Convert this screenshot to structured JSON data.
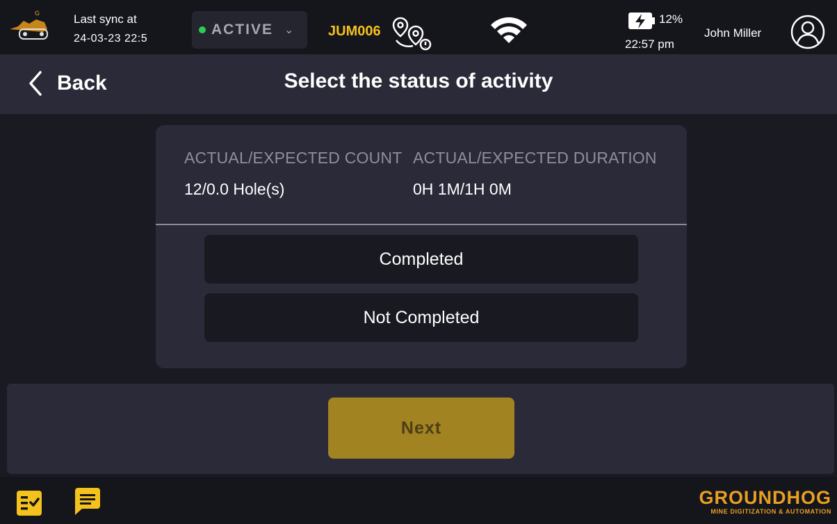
{
  "statusbar": {
    "sync_label": "Last sync at",
    "sync_time": "24-03-23 22:5",
    "status": "ACTIVE",
    "machine_id": "JUM006",
    "battery_percent": "12%",
    "time": "22:57 pm",
    "user_name": "John Miller",
    "icons": [
      "excavator-logo-icon",
      "route-icon",
      "wifi-icon",
      "battery-charging-icon",
      "user-avatar-icon"
    ]
  },
  "header": {
    "back_label": "Back",
    "title": "Select the status of activity"
  },
  "card": {
    "count_label": "ACTUAL/EXPECTED COUNT",
    "count_value": "12/0.0 Hole(s)",
    "duration_label": "ACTUAL/EXPECTED DURATION",
    "duration_value": "0H 1M/1H 0M",
    "options": [
      {
        "label": "Completed"
      },
      {
        "label": "Not Completed"
      }
    ]
  },
  "footer": {
    "next_label": "Next"
  },
  "bottombar": {
    "brand_name": "GROUNDHOG",
    "brand_tagline": "MINE DIGITIZATION & AUTOMATION",
    "icons": [
      "checklist-icon",
      "chat-icon"
    ]
  },
  "colors": {
    "background": "#1a1a23",
    "panel": "#2a2a38",
    "accent_yellow": "#f4c21c",
    "next_button": "#a28321",
    "active_dot": "#2ecc54",
    "brand_orange": "#e8a021"
  }
}
